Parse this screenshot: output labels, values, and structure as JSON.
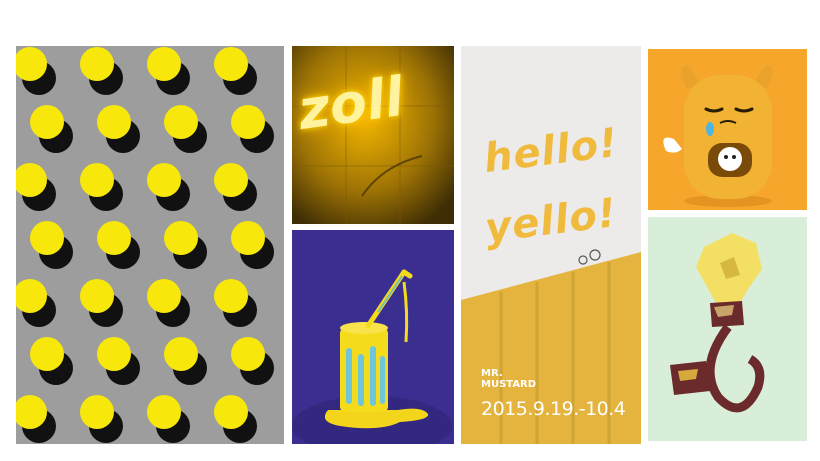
{
  "poster": {
    "line1": "hello!",
    "line2": "yello!",
    "brand": "MR.\nMUSTARD",
    "dates": "2015.9.19.-10.4"
  },
  "neon": {
    "text": "zoll"
  },
  "colors": {
    "dot_yellow": "#f7e70a",
    "mustard": "#e3b33f",
    "can_background": "#3b2f8f",
    "toy_background": "#f5a72c",
    "bulb_background": "#d9eed9"
  }
}
